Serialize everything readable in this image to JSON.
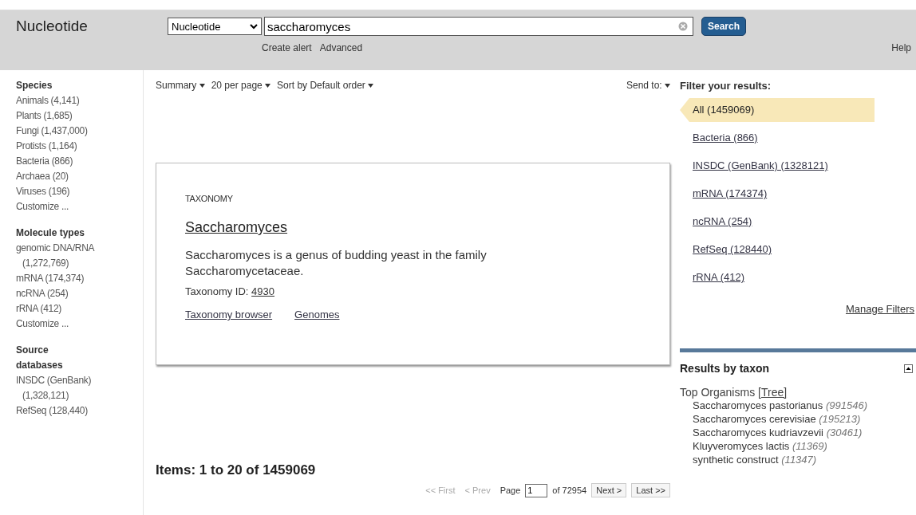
{
  "header": {
    "db_title": "Nucleotide",
    "db_select": "Nucleotide",
    "query": "saccharomyces",
    "search_button": "Search",
    "links": [
      "Create alert",
      "Advanced"
    ],
    "help": "Help"
  },
  "sidebar": [
    {
      "title": "Species",
      "items": [
        "Animals (4,141)",
        "Plants (1,685)",
        "Fungi (1,437,000)",
        "Protists (1,164)",
        "Bacteria (866)",
        "Archaea (20)",
        "Viruses (196)"
      ],
      "customize": "Customize ..."
    },
    {
      "title": "Molecule types",
      "items": [
        "genomic DNA/RNA (1,272,769)",
        "mRNA (174,374)",
        "ncRNA (254)",
        "rRNA (412)"
      ],
      "customize": "Customize ..."
    },
    {
      "title": "Source databases",
      "items": [
        "INSDC (GenBank) (1,328,121)",
        "RefSeq (128,440)"
      ]
    }
  ],
  "toolbar": {
    "menus": [
      "Summary",
      "20 per page",
      "Sort by Default order"
    ],
    "send_to": "Send to:"
  },
  "taxonomy_card": {
    "kicker": "TAXONOMY",
    "title": "Saccharomyces",
    "description": "Saccharomyces is a genus of budding yeast in the family Saccharomycetaceae.",
    "id_label": "Taxonomy ID:",
    "id": "4930",
    "links": [
      "Taxonomy browser",
      "Genomes"
    ]
  },
  "items_summary": "Items: 1 to 20 of 1459069",
  "pager": {
    "first": "<< First",
    "prev": "< Prev",
    "page_label": "Page",
    "page": "1",
    "of": "of 72954",
    "next": "Next >",
    "last": "Last >>"
  },
  "filters": {
    "title": "Filter your results:",
    "items": [
      {
        "label": "All (1459069)",
        "selected": true
      },
      {
        "label": "Bacteria (866)",
        "selected": false
      },
      {
        "label": "INSDC (GenBank) (1328121)",
        "selected": false
      },
      {
        "label": "mRNA (174374)",
        "selected": false
      },
      {
        "label": "ncRNA (254)",
        "selected": false
      },
      {
        "label": "RefSeq (128440)",
        "selected": false
      },
      {
        "label": "rRNA (412)",
        "selected": false
      }
    ],
    "manage": "Manage Filters"
  },
  "taxon": {
    "title": "Results by taxon",
    "expanded": true,
    "top_label": "Top Organisms",
    "tree_link": "[Tree]",
    "organisms": [
      {
        "name": "Saccharomyces pastorianus",
        "count": "(991546)"
      },
      {
        "name": "Saccharomyces cerevisiae",
        "count": "(195213)"
      },
      {
        "name": "Saccharomyces kudriavzevii",
        "count": "(30461)"
      },
      {
        "name": "Kluyveromyces lactis",
        "count": "(11369)"
      },
      {
        "name": "synthetic construct",
        "count": "(11347)"
      }
    ]
  }
}
